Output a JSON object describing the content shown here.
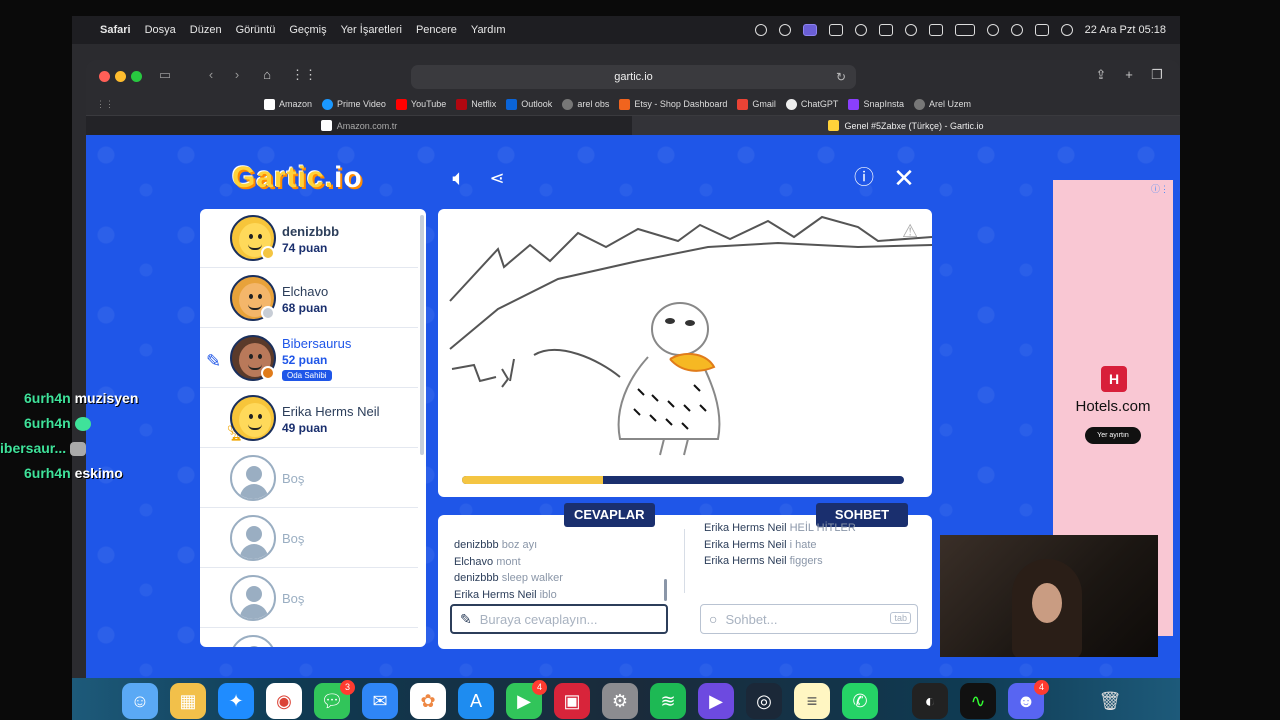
{
  "menubar": {
    "app": "Safari",
    "items": [
      "Dosya",
      "Düzen",
      "Görüntü",
      "Geçmiş",
      "Yer İşaretleri",
      "Pencere",
      "Yardım"
    ],
    "datetime": "22 Ara Pzt  05:18"
  },
  "browser": {
    "url": "gartic.io",
    "favorites": [
      "Amazon",
      "Prime Video",
      "YouTube",
      "Netflix",
      "Outlook",
      "arel obs",
      "Etsy - Shop Dashboard",
      "Gmail",
      "ChatGPT",
      "SnapInsta",
      "Arel Uzem"
    ],
    "tabs": [
      {
        "title": "Amazon.com.tr"
      },
      {
        "title": "Genel #5Zabxe (Türkçe) - Gartic.io"
      }
    ]
  },
  "game": {
    "logo_main": "Gartic.",
    "logo_io": "io",
    "players": [
      {
        "name": "denizbbb",
        "score": "74 puan",
        "medal_color": "#f4c542"
      },
      {
        "name": "Elchavo",
        "score": "68 puan",
        "medal_color": "#c7cdd6"
      },
      {
        "name": "Bibersaurus",
        "score": "52 puan",
        "medal_color": "#e07b1a",
        "badge": "Oda Sahibi"
      },
      {
        "name": "Erika Herms Neil",
        "score": "49 puan"
      },
      {
        "name": "Boş"
      },
      {
        "name": "Boş"
      },
      {
        "name": "Boş"
      }
    ],
    "progress": 0.32,
    "answers_tab": "CEVAPLAR",
    "chat_tab": "SOHBET",
    "answers": [
      {
        "user": "denizbbb",
        "text": "boz ayı"
      },
      {
        "user": "Elchavo",
        "text": "mont"
      },
      {
        "user": "denizbbb",
        "text": "sleep walker"
      },
      {
        "user": "Erika Herms Neil",
        "text": "iblo"
      }
    ],
    "chat": [
      {
        "user": "Erika Herms Neil",
        "text": "HEİL HİTLER"
      },
      {
        "user": "Erika Herms Neil",
        "text": "i hate"
      },
      {
        "user": "Erika Herms Neil",
        "text": "figgers"
      }
    ],
    "answer_placeholder": "Buraya cevaplayın...",
    "chat_placeholder": "Sohbet...",
    "tab_key": "tab"
  },
  "ad": {
    "brand": "Hotels.com",
    "button": "Yer ayırtın"
  },
  "stream_chat": [
    {
      "user": "6urh4n",
      "msg": "muzisyen"
    },
    {
      "user": "6urh4n",
      "msg": ""
    },
    {
      "user": "ibersaur...",
      "msg": ""
    },
    {
      "user": "6urh4n",
      "msg": "eskimo"
    }
  ],
  "dock": {
    "badges": {
      "messages": "3",
      "facetime": "4",
      "discord": "4"
    }
  }
}
